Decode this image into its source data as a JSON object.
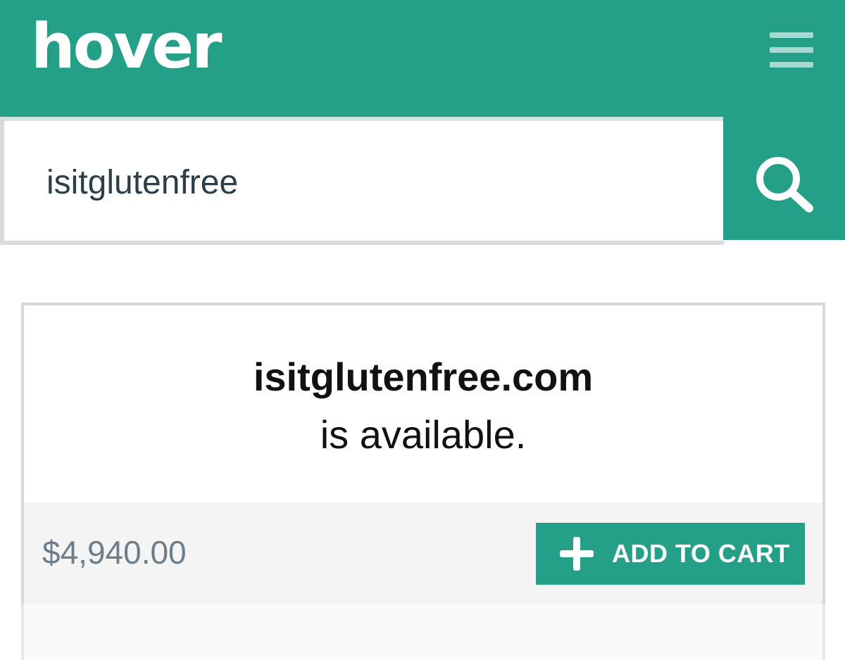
{
  "header": {
    "logo_text": "hover",
    "menu_icon": "hamburger-menu-icon"
  },
  "search": {
    "value": "isitglutenfree",
    "icon": "search-icon"
  },
  "result": {
    "domain": "isitglutenfree.com",
    "status": "is available.",
    "price": "$4,940.00",
    "add_to_cart_label": "ADD TO CART",
    "add_icon": "plus-icon"
  },
  "colors": {
    "brand": "#23a087",
    "menu_bars": "#a6d9cf",
    "price_text": "#6d7e8a",
    "price_bar_bg": "#f4f4f4",
    "border": "#d6d8d9"
  }
}
